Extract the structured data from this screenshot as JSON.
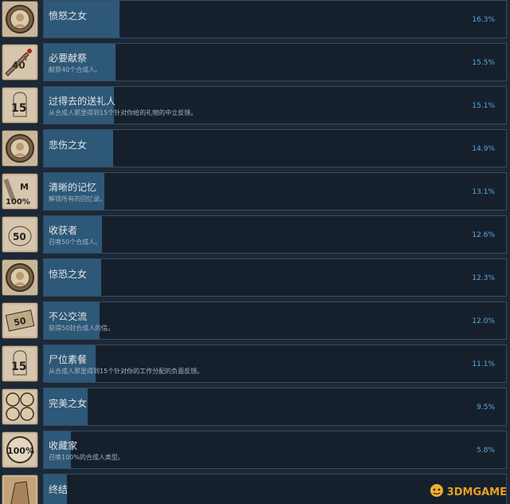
{
  "achievements": [
    {
      "name": "愤怒之女",
      "desc": "",
      "percent": "16.3%",
      "fill": 0.163,
      "icon": "woman-portrait-icon"
    },
    {
      "name": "必要献祭",
      "desc": "献祭40个合成人。",
      "percent": "15.5%",
      "fill": 0.155,
      "icon": "bloody-knife-40-icon"
    },
    {
      "name": "过得去的送礼人",
      "desc": "从合成人那里得到15个针对你给的礼物的中立反馈。",
      "percent": "15.1%",
      "fill": 0.151,
      "icon": "figure-15-icon"
    },
    {
      "name": "悲伤之女",
      "desc": "",
      "percent": "14.9%",
      "fill": 0.149,
      "icon": "woman-portrait-icon"
    },
    {
      "name": "清晰的记忆",
      "desc": "解锁所有的回忆录。",
      "percent": "13.1%",
      "fill": 0.131,
      "icon": "memory-100-icon"
    },
    {
      "name": "收获者",
      "desc": "召唤50个合成人。",
      "percent": "12.6%",
      "fill": 0.126,
      "icon": "harvester-50-icon"
    },
    {
      "name": "惊恐之女",
      "desc": "",
      "percent": "12.3%",
      "fill": 0.123,
      "icon": "woman-portrait-icon"
    },
    {
      "name": "不公交流",
      "desc": "获得50封合成人的信。",
      "percent": "12.0%",
      "fill": 0.12,
      "icon": "letter-50-icon"
    },
    {
      "name": "尸位素餐",
      "desc": "从合成人那里得到15个针对你的工作分配的负面反馈。",
      "percent": "11.1%",
      "fill": 0.111,
      "icon": "figure-15-icon"
    },
    {
      "name": "完美之女",
      "desc": "",
      "percent": "9.5%",
      "fill": 0.095,
      "icon": "four-portraits-icon"
    },
    {
      "name": "收藏家",
      "desc": "召唤100%的合成人类型。",
      "percent": "5.8%",
      "fill": 0.058,
      "icon": "collector-100-icon"
    },
    {
      "name": "终结",
      "desc": "",
      "percent": "",
      "fill": 0.05,
      "icon": "ending-icon"
    }
  ],
  "watermark": {
    "text": "3DMGAME",
    "icon": "3dm-logo-icon"
  }
}
